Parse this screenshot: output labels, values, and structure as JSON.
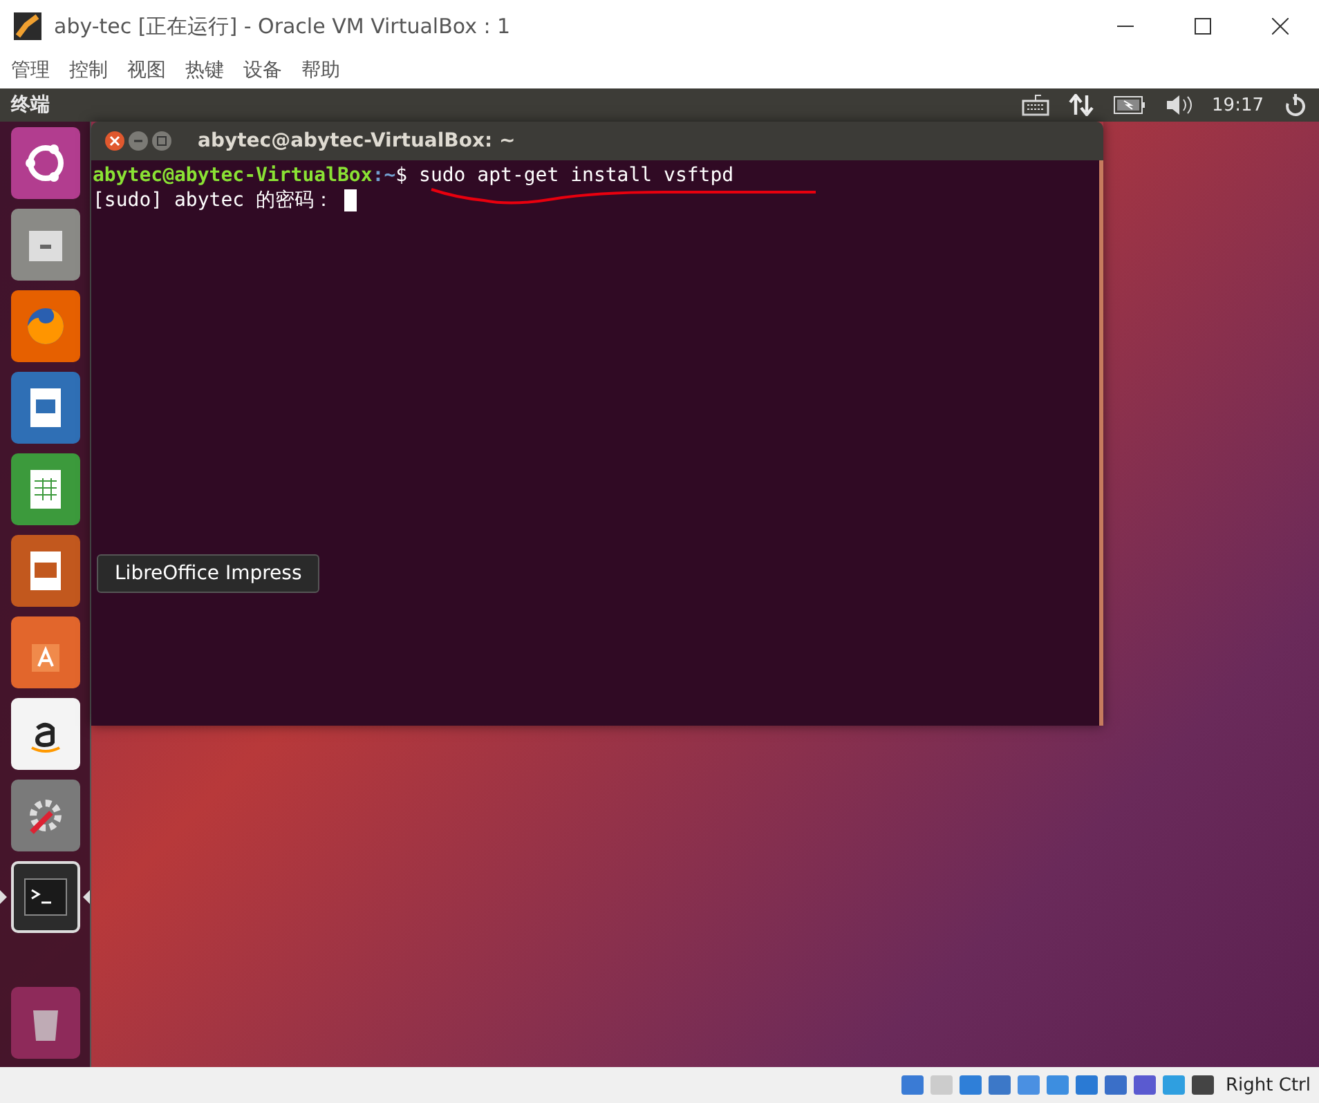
{
  "window": {
    "title": "aby-tec [正在运行] - Oracle VM VirtualBox : 1"
  },
  "menu": [
    "管理",
    "控制",
    "视图",
    "热键",
    "设备",
    "帮助"
  ],
  "top_panel": {
    "app_name": "终端",
    "clock": "19:17"
  },
  "launcher": [
    {
      "kind": "ubuntu",
      "active": false
    },
    {
      "kind": "files",
      "active": false
    },
    {
      "kind": "firefox",
      "active": false
    },
    {
      "kind": "writer",
      "active": false
    },
    {
      "kind": "calc",
      "active": false
    },
    {
      "kind": "impress",
      "active": false
    },
    {
      "kind": "software",
      "active": false
    },
    {
      "kind": "amazon",
      "active": false
    },
    {
      "kind": "settings",
      "active": false
    },
    {
      "kind": "terminal",
      "active": true
    },
    {
      "kind": "trash",
      "active": false
    }
  ],
  "tooltip": "LibreOffice Impress",
  "terminal": {
    "title": "abytec@abytec-VirtualBox: ~",
    "prompt_user": "abytec@abytec-VirtualBox",
    "prompt_path": ":~",
    "command": "$ sudo apt-get install vsftpd",
    "password_prompt": "[sudo] abytec 的密码："
  },
  "status_bar": {
    "host_key": "Right Ctrl"
  }
}
